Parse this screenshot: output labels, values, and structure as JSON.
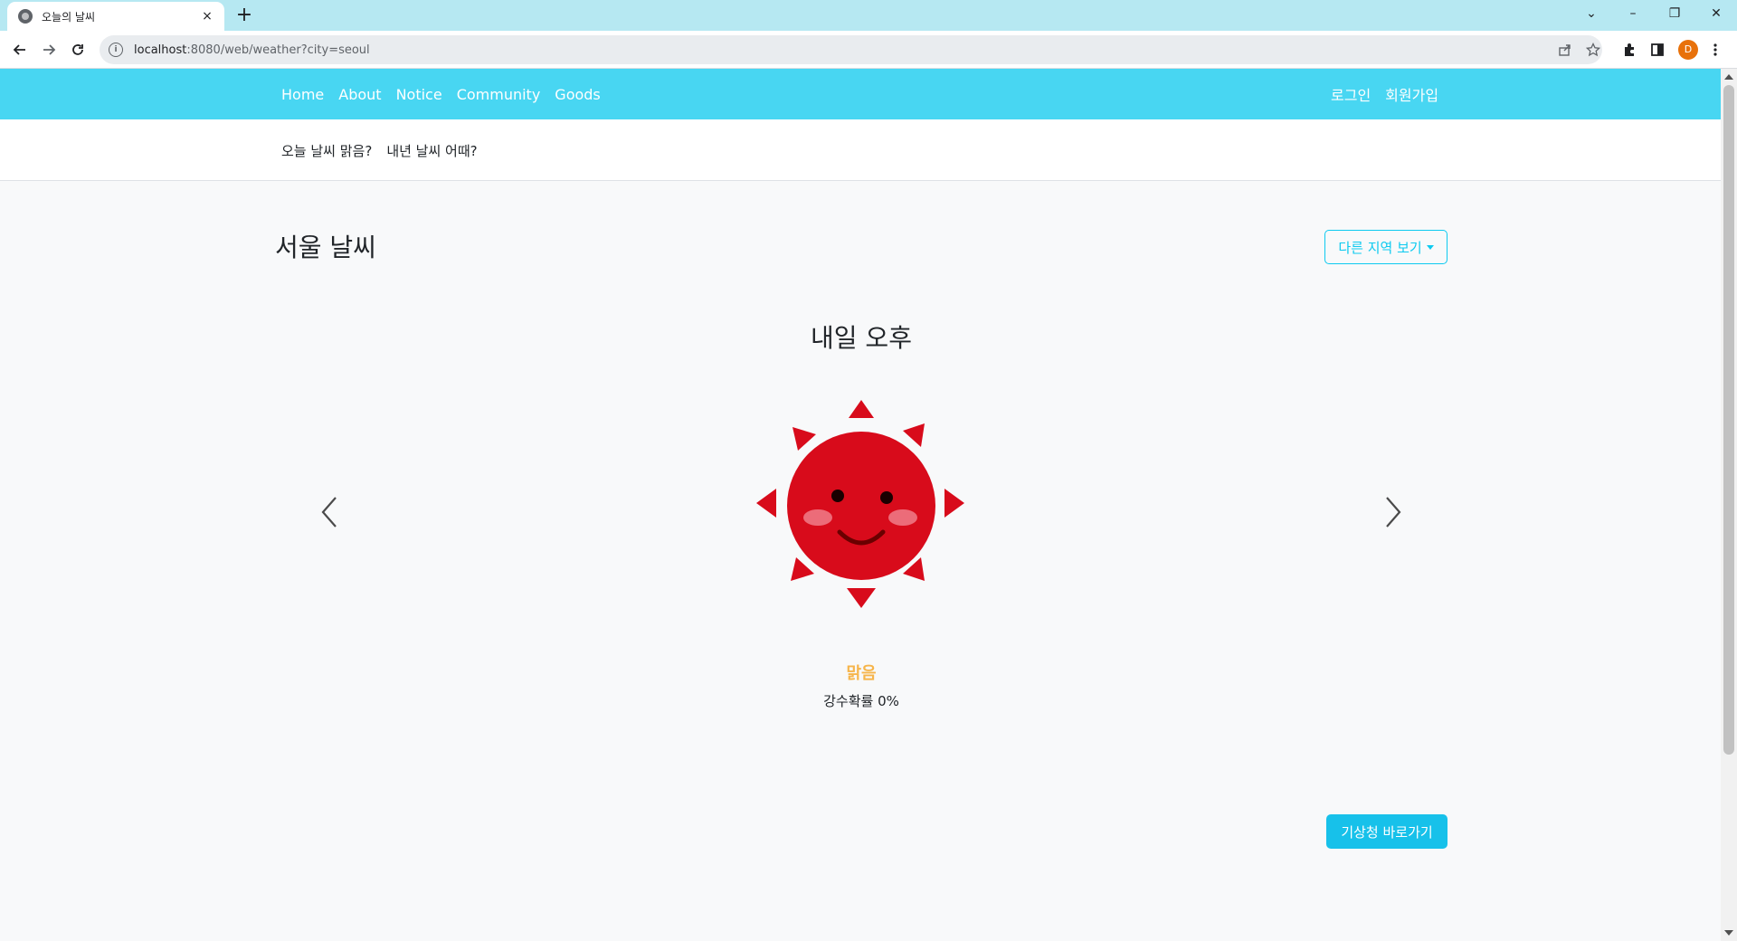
{
  "browser": {
    "tab_title": "오늘의 날씨",
    "tab_close": "×",
    "new_tab": "+",
    "url_host": "localhost",
    "url_rest": ":8080/web/weather?city=seoul",
    "profile_initial": "D",
    "window_controls": [
      "⌄",
      "–",
      "❐",
      "✕"
    ]
  },
  "navbar": {
    "links": [
      "Home",
      "About",
      "Notice",
      "Community",
      "Goods"
    ],
    "auth": [
      "로그인",
      "회원가입"
    ]
  },
  "subnav": {
    "links": [
      "오늘 날씨 맑음?",
      "내년 날씨 어때?"
    ]
  },
  "main": {
    "city_title": "서울 날씨",
    "region_button": "다른 지역 보기",
    "slide": {
      "title": "내일 오후",
      "icon": "sun-face-icon",
      "status": "맑음",
      "rain": "강수확률 0%"
    },
    "kma_button": "기상청 바로가기"
  },
  "colors": {
    "navbar": "#48d6f2",
    "accent": "#0dcaf0",
    "status": "#f6b54b",
    "sun": "#d80b1b"
  }
}
